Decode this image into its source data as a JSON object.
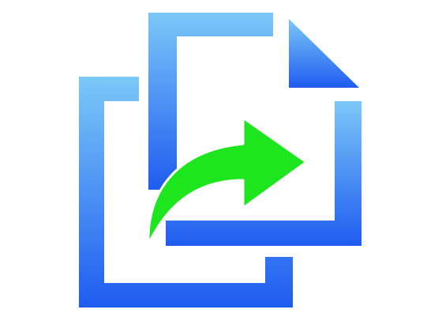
{
  "icon": {
    "name": "copy-export-icon",
    "colors": {
      "blue_light": "#7cc8f8",
      "blue_dark": "#1e5cf0",
      "arrow_green": "#1ee61e",
      "arrow_outline": "#ffffff",
      "background": "#ffffff"
    }
  }
}
